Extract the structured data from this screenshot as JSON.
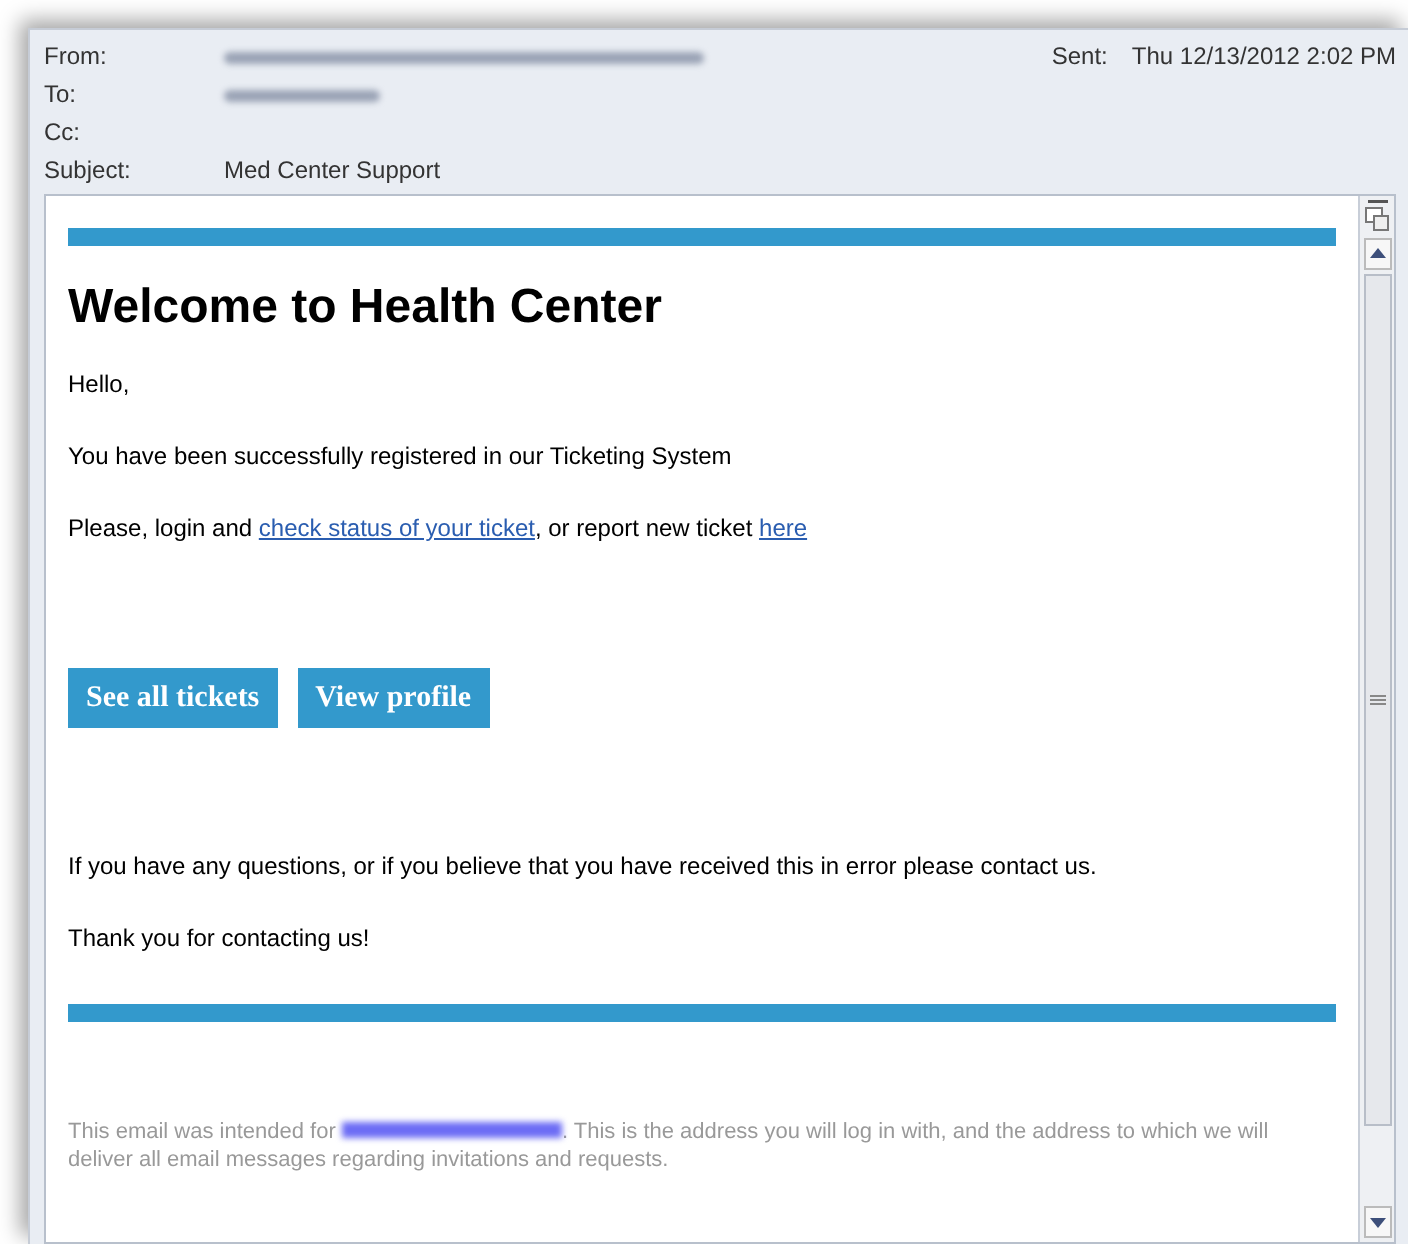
{
  "header": {
    "from_label": "From:",
    "to_label": "To:",
    "cc_label": "Cc:",
    "subject_label": "Subject:",
    "subject": "Med Center Support",
    "sent_label": "Sent:",
    "sent": "Thu 12/13/2012 2:02 PM"
  },
  "email": {
    "heading": "Welcome to Health Center",
    "greeting": "Hello,",
    "registered": "You have been successfully registered in our Ticketing System",
    "login_before": "Please, login and ",
    "login_link": "check status of your ticket",
    "login_middle": ", or report new ticket ",
    "login_link2": "here",
    "buttons": [
      "See all tickets",
      "View profile"
    ],
    "questions": "If you have any questions, or if you believe that you have received this in error please contact us.",
    "thanks": "Thank you for contacting us!",
    "footer_before": "This email was intended for ",
    "footer_after": ". This is the address you will log in with, and the address to which we will deliver all email messages regarding invitations and requests."
  }
}
